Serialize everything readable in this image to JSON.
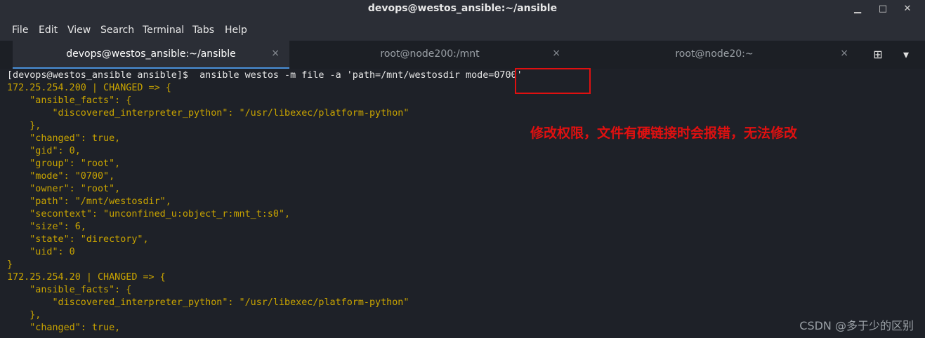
{
  "window": {
    "title": "devops@westos_ansible:~/ansible",
    "min": "▁",
    "max": "□",
    "close": "✕"
  },
  "menu": [
    "File",
    "Edit",
    "View",
    "Search",
    "Terminal",
    "Tabs",
    "Help"
  ],
  "tabs": [
    {
      "label": "devops@westos_ansible:~/ansible",
      "close": "×"
    },
    {
      "label": "root@node200:/mnt",
      "close": "×"
    },
    {
      "label": "root@node20:~",
      "close": "×"
    }
  ],
  "tab_icons": {
    "new_tab": "⊞",
    "menu": "▾"
  },
  "terminal": {
    "lines": [
      "[devops@westos_ansible ansible]$  ansible westos -m file -a 'path=/mnt/westosdir mode=0700'",
      "172.25.254.200 | CHANGED => {",
      "    \"ansible_facts\": {",
      "        \"discovered_interpreter_python\": \"/usr/libexec/platform-python\"",
      "    },",
      "    \"changed\": true,",
      "    \"gid\": 0,",
      "    \"group\": \"root\",",
      "    \"mode\": \"0700\",",
      "    \"owner\": \"root\",",
      "    \"path\": \"/mnt/westosdir\",",
      "    \"secontext\": \"unconfined_u:object_r:mnt_t:s0\",",
      "    \"size\": 6,",
      "    \"state\": \"directory\",",
      "    \"uid\": 0",
      "}",
      "172.25.254.20 | CHANGED => {",
      "    \"ansible_facts\": {",
      "        \"discovered_interpreter_python\": \"/usr/libexec/platform-python\"",
      "    },",
      "    \"changed\": true,"
    ]
  },
  "annotation": "修改权限，文件有硬链接时会报错，无法修改",
  "watermark": "CSDN @多于少的区别",
  "colors": {
    "output": "#c9a400",
    "annotation": "#e01010"
  }
}
